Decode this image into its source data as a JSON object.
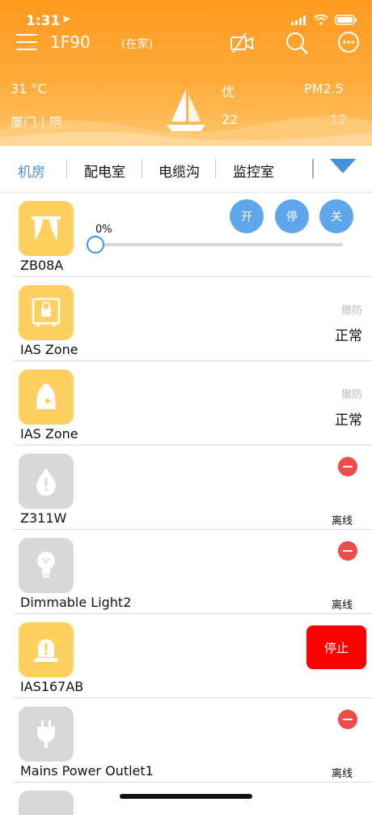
{
  "status_bar": {
    "time": "1:31"
  },
  "header": {
    "floor": "1F90",
    "mode": "(在家)"
  },
  "weather": {
    "temp": "31 °C",
    "location": "厦门 | 阴",
    "aqi_label": "优",
    "aqi_value": "22",
    "pm_label": "PM2.5",
    "pm_value": "12"
  },
  "tabs": [
    {
      "label": "机房",
      "active": true
    },
    {
      "label": "配电室",
      "active": false
    },
    {
      "label": "电缆沟",
      "active": false
    },
    {
      "label": "监控室",
      "active": false
    }
  ],
  "devices": [
    {
      "name": "ZB08A",
      "icon": "curtain-icon",
      "percent_label": "0%",
      "level": 0,
      "buttons": [
        "开",
        "停",
        "关"
      ]
    },
    {
      "name": "IAS Zone",
      "icon": "safe-icon",
      "guard": "撤防",
      "state": "正常"
    },
    {
      "name": "IAS Zone",
      "icon": "sensor-icon",
      "guard": "撤防",
      "state": "正常"
    },
    {
      "name": "Z311W",
      "icon": "water-leak-icon",
      "status": "离线"
    },
    {
      "name": "Dimmable Light2",
      "icon": "bulb-icon",
      "status": "离线"
    },
    {
      "name": "IAS167AB",
      "icon": "alarm-light-icon",
      "action": "停止"
    },
    {
      "name": "Mains Power Outlet1",
      "icon": "plug-icon",
      "status": "离线"
    }
  ],
  "colors": {
    "header": "#ff9a1f",
    "accent": "#4a90d9",
    "offline_red": "#ef4b4b",
    "stop_red": "#ff0000",
    "device_on": "#ffd060"
  }
}
